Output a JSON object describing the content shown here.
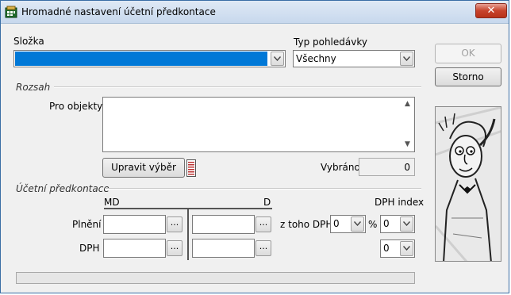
{
  "window": {
    "title": "Hromadné nastavení účetní předkontace",
    "close_label": "✕"
  },
  "slozka": {
    "label": "Složka",
    "value": ""
  },
  "typ_pohledavky": {
    "label": "Typ pohledávky",
    "value": "Všechny"
  },
  "buttons": {
    "ok": "OK",
    "storno": "Storno",
    "upravit_vyber": "Upravit výběr"
  },
  "rozsah": {
    "section_label": "Rozsah",
    "pro_objekty_label": "Pro objekty",
    "vybrano_label": "Vybráno",
    "vybrano_value": "0"
  },
  "predkontace": {
    "section_label": "Účetní předkontace",
    "md_label": "MD",
    "d_label": "D",
    "dph_index_label": "DPH index",
    "plneni_label": "Plnění",
    "dph_label": "DPH",
    "z_toho_dph_label": "z toho DPH",
    "percent_label": "%",
    "z_toho_dph_value": "0",
    "dph_index_plneni_value": "0",
    "dph_index_dph_value": "0",
    "dots_label": "..."
  },
  "colors": {
    "selection": "#0078d7",
    "title_bar": "#c7d8ed",
    "close_button": "#c7432c"
  }
}
